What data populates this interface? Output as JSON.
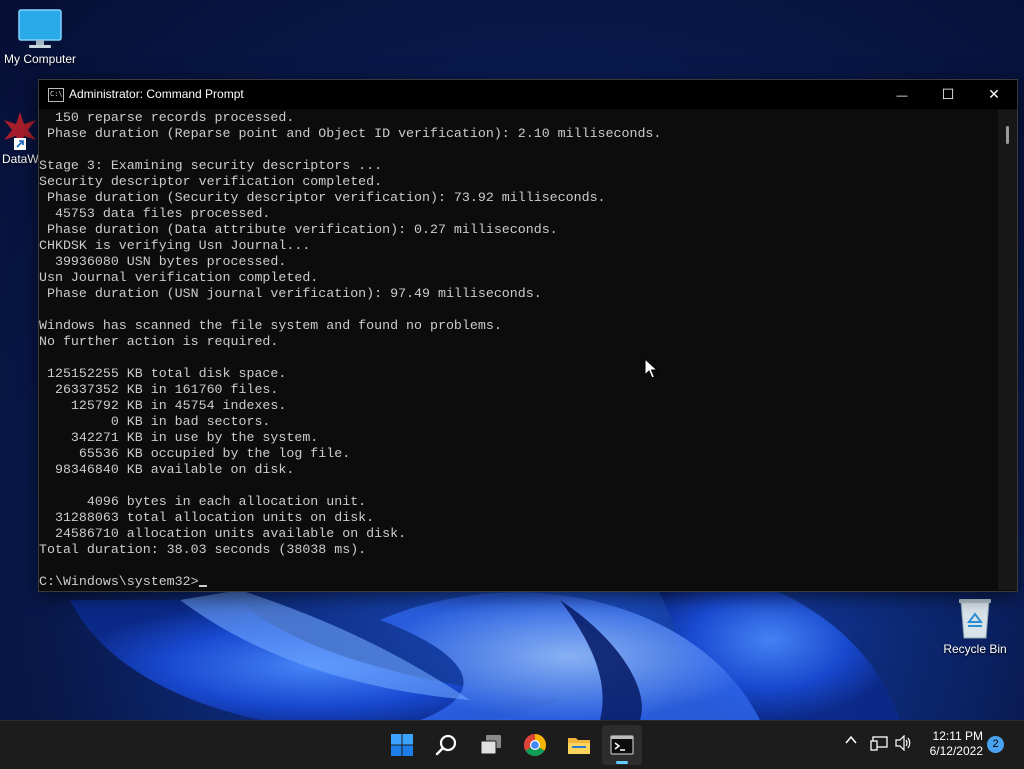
{
  "desktop": {
    "icons": [
      {
        "label": "My Computer"
      },
      {
        "label": "DataW"
      },
      {
        "label": "Recycle Bin"
      }
    ]
  },
  "window": {
    "title": "Administrator: Command Prompt",
    "icon_label": "C:\\",
    "controls": {
      "minimize": "—",
      "maximize": "☐",
      "close": "✕"
    }
  },
  "console": {
    "lines": [
      "  150 reparse records processed.",
      " Phase duration (Reparse point and Object ID verification): 2.10 milliseconds.",
      "",
      "Stage 3: Examining security descriptors ...",
      "Security descriptor verification completed.",
      " Phase duration (Security descriptor verification): 73.92 milliseconds.",
      "  45753 data files processed.",
      " Phase duration (Data attribute verification): 0.27 milliseconds.",
      "CHKDSK is verifying Usn Journal...",
      "  39936080 USN bytes processed.",
      "Usn Journal verification completed.",
      " Phase duration (USN journal verification): 97.49 milliseconds.",
      "",
      "Windows has scanned the file system and found no problems.",
      "No further action is required.",
      "",
      " 125152255 KB total disk space.",
      "  26337352 KB in 161760 files.",
      "    125792 KB in 45754 indexes.",
      "         0 KB in bad sectors.",
      "    342271 KB in use by the system.",
      "     65536 KB occupied by the log file.",
      "  98346840 KB available on disk.",
      "",
      "      4096 bytes in each allocation unit.",
      "  31288063 total allocation units on disk.",
      "  24586710 allocation units available on disk.",
      "Total duration: 38.03 seconds (38038 ms).",
      ""
    ],
    "prompt": "C:\\Windows\\system32>"
  },
  "taskbar": {
    "apps": [
      "start-icon",
      "search-icon",
      "task-view-icon",
      "chrome-icon",
      "file-explorer-icon",
      "command-prompt-icon"
    ],
    "tray": {
      "chevron": "^",
      "time": "12:11 PM",
      "date": "6/12/2022",
      "notification_count": "2"
    }
  },
  "colors": {
    "console_bg": "#0c0c0c",
    "console_text": "#cccccc",
    "taskbar_bg": "#1c1c1c",
    "accent": "#60cdff"
  }
}
